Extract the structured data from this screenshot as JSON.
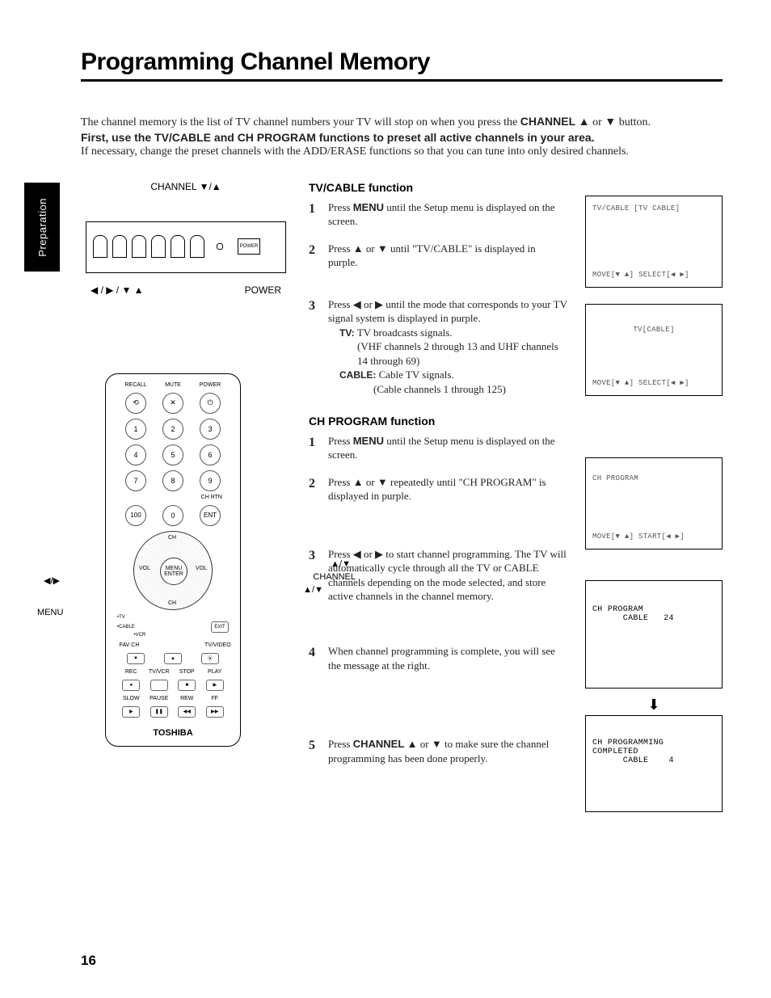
{
  "title": "Programming Channel Memory",
  "intro": {
    "line1_a": "The channel memory is the list of TV channel numbers your TV will stop on when you press the ",
    "line1_b": "CHANNEL ▲",
    "line1_c": " or ",
    "line1_d": "▼",
    "line1_e": " button.",
    "line2": "First, use the TV/CABLE and CH PROGRAM functions to preset all active channels in your area.",
    "line3": "If necessary, change the preset channels with the ADD/ERASE functions so that you can tune into only desired channels."
  },
  "sidetab": "Preparation",
  "tvPanel": {
    "topLabel": "CHANNEL ▼/▲",
    "bottomLeft": "◀ / ▶ / ▼ ▲",
    "bottomRight": "POWER",
    "smallBox": "POWER"
  },
  "remote": {
    "row1_labels": [
      "RECALL",
      "MUTE",
      "POWER"
    ],
    "digits": [
      "1",
      "2",
      "3",
      "4",
      "5",
      "6",
      "7",
      "8",
      "9",
      "100",
      "0",
      "ENT"
    ],
    "chrtn": "CH RTN",
    "dpad": {
      "up": "CH",
      "down": "CH",
      "left": "VOL",
      "right": "VOL",
      "center": "MENU\nENTER"
    },
    "sourceRow": [
      "•TV",
      "•CABLE",
      "•VCR",
      "EXIT"
    ],
    "favRow": [
      "FAV CH",
      "",
      "TV/VIDEO"
    ],
    "vcrRow1": [
      "REC",
      "TV/VCR",
      "STOP",
      "PLAY"
    ],
    "vcrRow2": [
      "SLOW",
      "PAUSE",
      "REW",
      "FF"
    ],
    "brand": "TOSHIBA",
    "callouts": {
      "leftright": "◀/▶",
      "menu": "MENU",
      "updown1": "▲/▼",
      "channel": "CHANNEL",
      "updown2": "▲/▼"
    }
  },
  "sections": {
    "tvcable": {
      "heading": "TV/CABLE function",
      "steps": [
        {
          "pre": "Press ",
          "bold": "MENU",
          "post": " until the Setup menu is displayed on the screen."
        },
        {
          "text": "Press ▲ or ▼ until \"TV/CABLE\" is displayed in purple."
        },
        {
          "text": "Press ◀ or ▶ until the mode that corresponds to your TV signal system is displayed in purple.",
          "sub": [
            {
              "label": "TV:",
              "desc": "TV broadcasts signals.",
              "paren": "(VHF channels 2 through 13 and UHF channels 14 through 69)"
            },
            {
              "label": "CABLE:",
              "desc": "Cable TV signals.",
              "paren": "(Cable channels 1 through 125)"
            }
          ]
        }
      ]
    },
    "chprogram": {
      "heading": "CH PROGRAM function",
      "steps": [
        {
          "pre": "Press ",
          "bold": "MENU",
          "post": " until the Setup menu is displayed on the screen."
        },
        {
          "text": "Press ▲ or ▼ repeatedly until \"CH PROGRAM\" is displayed in purple."
        },
        {
          "text": "Press ◀ or ▶ to start channel programming. The TV will automatically cycle through all the TV or CABLE channels depending on the mode selected, and store active channels in the channel memory."
        },
        {
          "text": "When channel programming is complete, you will see the message at the right."
        },
        {
          "pre": "Press ",
          "bold": "CHANNEL ▲",
          "mid": " or ",
          "bold2": "▼",
          "post": " to make sure the channel programming has been done properly."
        }
      ]
    }
  },
  "osd": {
    "box1": {
      "top": "TV/CABLE    [TV  CABLE]",
      "bot": "MOVE[▼ ▲]  SELECT[◀ ▶]"
    },
    "box2": {
      "top": "TV[CABLE]",
      "bot": "MOVE[▼ ▲]  SELECT[◀ ▶]"
    },
    "box3": {
      "top": "CH PROGRAM",
      "bot": "MOVE[▼ ▲]  START[◀ ▶]"
    },
    "box4": {
      "top": "CH PROGRAM\n      CABLE   24",
      "bot": ""
    },
    "box5": {
      "top": "CH PROGRAMMING\nCOMPLETED\n      CABLE    4",
      "bot": ""
    }
  },
  "pageNumber": "16"
}
